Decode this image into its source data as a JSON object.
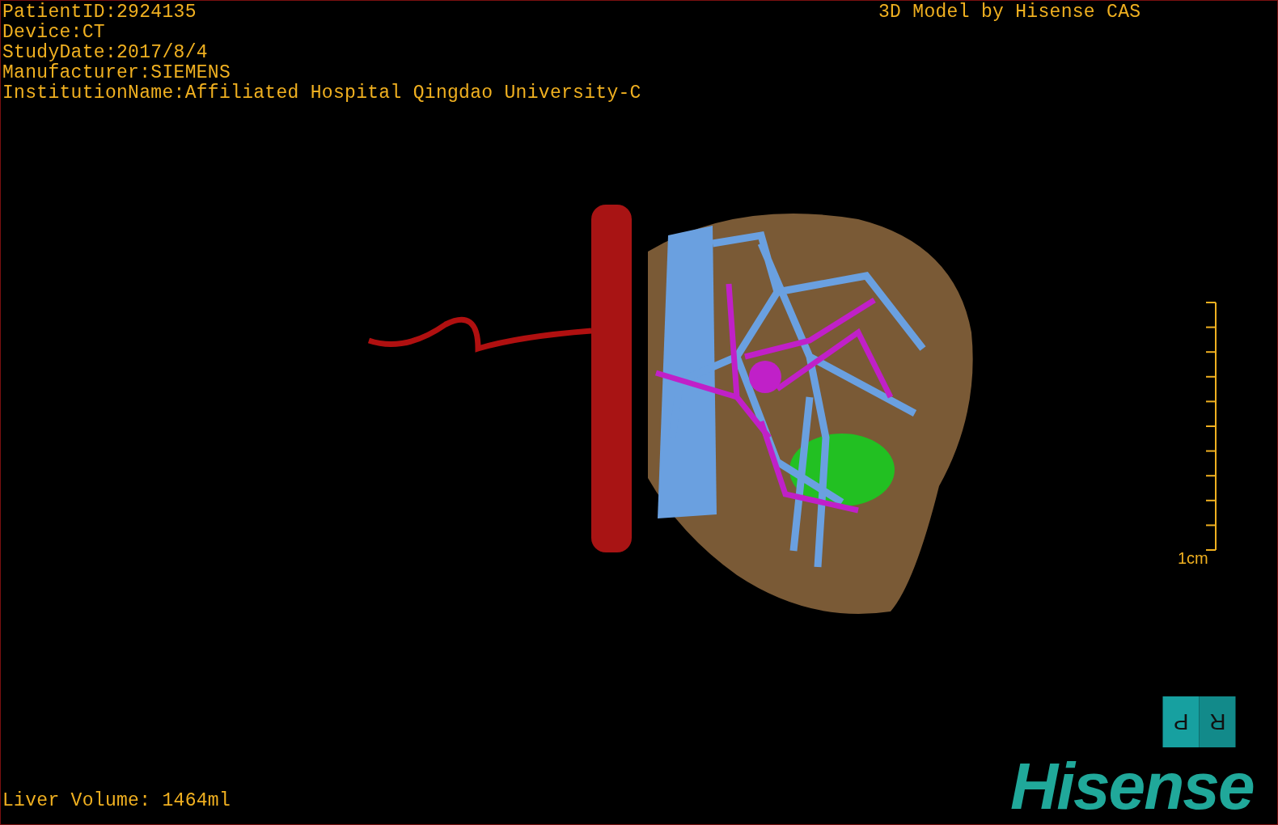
{
  "study_info": [
    "PatientID:2924135",
    "Device:CT",
    "StudyDate:2017/8/4",
    "Manufacturer:SIEMENS",
    "InstitutionName:Affiliated Hospital Qingdao University-C"
  ],
  "model_credit": "3D Model by Hisense CAS",
  "scale_bar": {
    "label": "1cm"
  },
  "orientation_cube": {
    "faces": [
      "P",
      "R"
    ]
  },
  "liver_volume": "Liver Volume: 1464ml",
  "logo": "Hisense"
}
